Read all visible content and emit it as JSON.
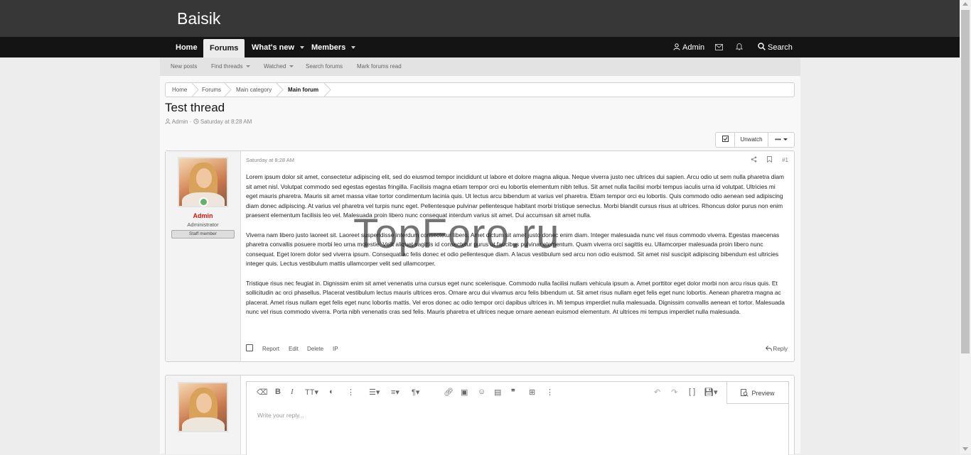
{
  "site": {
    "logo": "Baisik"
  },
  "nav": {
    "home": "Home",
    "forums": "Forums",
    "whats_new": "What's new",
    "members": "Members",
    "user": "Admin",
    "search": "Search"
  },
  "subnav": {
    "new_posts": "New posts",
    "find_threads": "Find threads",
    "watched": "Watched",
    "search_forums": "Search forums",
    "mark_read": "Mark forums read"
  },
  "breadcrumb": [
    "Home",
    "Forums",
    "Main category",
    "Main forum"
  ],
  "thread": {
    "title": "Test thread",
    "author": "Admin",
    "date": "Saturday at 8:28 AM",
    "unwatch": "Unwatch",
    "more": "•••"
  },
  "post": {
    "username": "Admin",
    "user_title": "Administrator",
    "banner": "Staff member",
    "date": "Saturday at 8:28 AM",
    "number": "#1",
    "paragraphs": [
      "Lorem ipsum dolor sit amet, consectetur adipiscing elit, sed do eiusmod tempor incididunt ut labore et dolore magna aliqua. Neque viverra justo nec ultrices dui sapien. Arcu odio ut sem nulla pharetra diam sit amet nisl. Volutpat commodo sed egestas egestas fringilla. Facilisis magna etiam tempor orci eu lobortis elementum nibh tellus. Sit amet nulla facilisi morbi tempus iaculis urna id volutpat. Ultricies mi eget mauris pharetra. Mauris sit amet massa vitae tortor condimentum lacinia quis. Ut lectus arcu bibendum at varius vel pharetra. Etiam tempor orci eu lobortis. Quis commodo odio aenean sed adipiscing diam donec adipiscing. At varius vel pharetra vel turpis nunc eget. Pellentesque pulvinar pellentesque habitant morbi tristique senectus. Morbi blandit cursus risus at ultrices. Rhoncus dolor purus non enim praesent elementum facilisis leo vel. Malesuada proin libero nunc consequat interdum varius sit amet. Dui accumsan sit amet nulla.",
      "Viverra nam libero justo laoreet sit. Laoreet suspendisse interdum consectetur libero. Amet dictum sit amet justo donec enim diam. Integer malesuada nunc vel risus commodo viverra. Egestas maecenas pharetra convallis posuere morbi leo urna molestie. Velit aliquet sagittis id consectetur purus ut faucibus pulvinar elementum. Quam viverra orci sagittis eu. Ullamcorper malesuada proin libero nunc consequat. Eget lorem dolor sed viverra ipsum. Consequat ac felis donec et odio pellentesque diam. A lacus vestibulum sed arcu non odio euismod. Sit amet nisl suscipit adipiscing bibendum est ultricies integer quis. Lectus vestibulum mattis ullamcorper velit sed ullamcorper.",
      "Tristique risus nec feugiat in. Dignissim enim sit amet venenatis urna cursus eget nunc scelerisque. Commodo nulla facilisi nullam vehicula ipsum a. Amet porttitor eget dolor morbi non arcu risus quis. Et sollicitudin ac orci phasellus. Placerat vestibulum lectus mauris ultrices eros. Ornare arcu dui vivamus arcu felis bibendum ut. Sit amet risus nullam eget felis eget nunc lobortis. Aenean pharetra magna ac placerat. Amet risus nullam eget felis eget nunc lobortis mattis. Vel eros donec ac odio tempor orci dapibus ultrices in. Mi tempus imperdiet nulla malesuada. Dignissim convallis aenean et tortor. Malesuada nunc vel risus commodo viverra. Porta nibh venenatis cras sed felis. Mauris pharetra et ultrices neque ornare aenean euismod elementum. At ultrices mi tempus imperdiet nulla malesuada."
    ],
    "actions": {
      "report": "Report",
      "edit": "Edit",
      "delete": "Delete",
      "ip": "IP",
      "reply": "Reply"
    }
  },
  "watermark": "TopForo.ru",
  "editor": {
    "placeholder": "Write your reply...",
    "preview": "Preview"
  },
  "colors": {
    "topbar": "#373737",
    "navbar": "#141414",
    "username": "#d8130d",
    "online": "#63b265"
  }
}
